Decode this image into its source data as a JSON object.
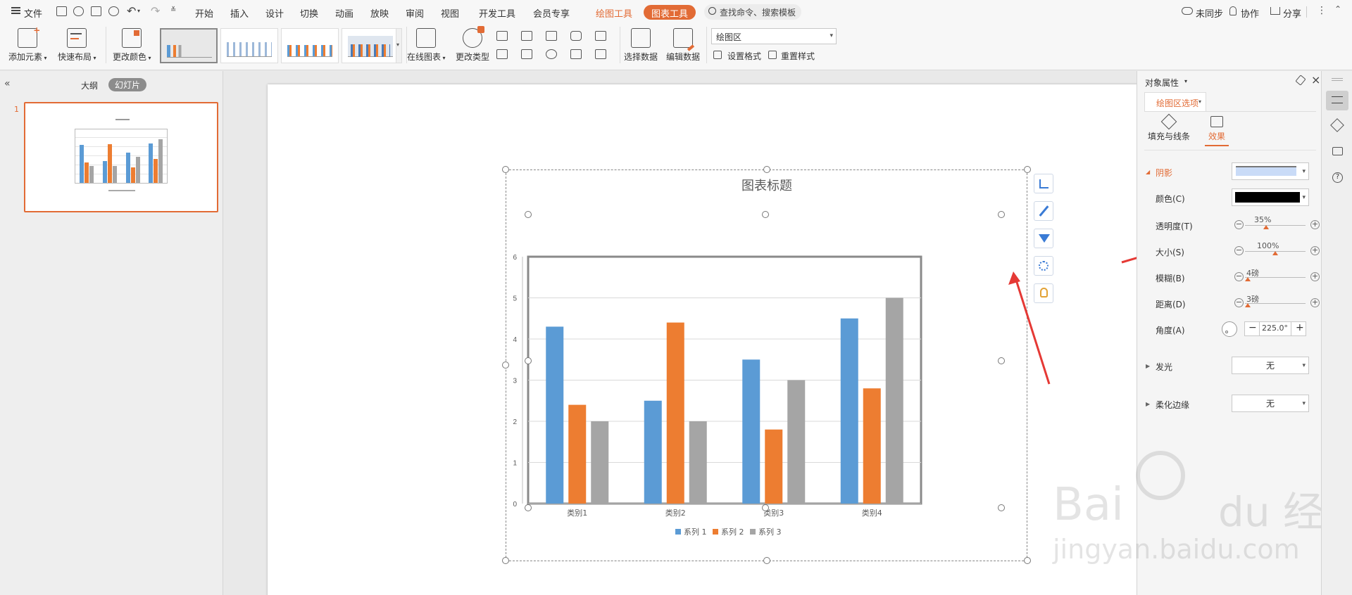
{
  "menubar": {
    "file": "文件",
    "tabs": [
      "开始",
      "插入",
      "设计",
      "切换",
      "动画",
      "放映",
      "审阅",
      "视图",
      "开发工具",
      "会员专享"
    ],
    "drawing_tools": "绘图工具",
    "chart_tools": "图表工具",
    "search": "查找命令、搜索模板",
    "unsynced": "未同步",
    "collaborate": "协作",
    "share": "分享"
  },
  "toolbar": {
    "add_element": "添加元素",
    "quick_layout": "快速布局",
    "change_color": "更改颜色",
    "online_chart": "在线图表",
    "change_type": "更改类型",
    "select_data": "选择数据",
    "edit_data": "编辑数据",
    "element_select": "绘图区",
    "set_format": "设置格式",
    "reset_style": "重置样式"
  },
  "leftpane": {
    "outline_tab": "大纲",
    "slides_tab": "幻灯片",
    "slide_number": "1"
  },
  "chart_data": {
    "type": "bar",
    "title": "图表标题",
    "categories": [
      "类别1",
      "类别2",
      "类别3",
      "类别4"
    ],
    "series": [
      {
        "name": "系列 1",
        "values": [
          4.3,
          2.5,
          3.5,
          4.5
        ],
        "color": "#5b9bd5"
      },
      {
        "name": "系列 2",
        "values": [
          2.4,
          4.4,
          1.8,
          2.8
        ],
        "color": "#ed7d31"
      },
      {
        "name": "系列 3",
        "values": [
          2,
          2,
          3,
          5
        ],
        "color": "#a5a5a5"
      }
    ],
    "ylim": [
      0,
      6
    ],
    "yticks": [
      "0",
      "1",
      "2",
      "3",
      "4",
      "5",
      "6"
    ],
    "grid": true,
    "legend": "bottom"
  },
  "panel": {
    "title": "对象属性",
    "options_tab": "绘图区选项",
    "fill_line_tab": "填充与线条",
    "effects_tab": "效果",
    "shadow": "阴影",
    "color": "颜色(C)",
    "transparency": "透明度(T)",
    "transparency_value": "35%",
    "transparency_level": 0.35,
    "size": "大小(S)",
    "size_value": "100%",
    "size_level": 0.5,
    "blur": "模糊(B)",
    "blur_value": "4磅",
    "blur_level": 0.05,
    "distance": "距离(D)",
    "distance_value": "3磅",
    "distance_level": 0.05,
    "angle": "角度(A)",
    "angle_value": "225.0°",
    "glow": "发光",
    "glow_value": "无",
    "soft_edges": "柔化边缘",
    "soft_edges_value": "无",
    "shadow_color": "#000000"
  },
  "watermark": {
    "brand": "Bai du 经验",
    "url": "jingyan.baidu.com"
  }
}
